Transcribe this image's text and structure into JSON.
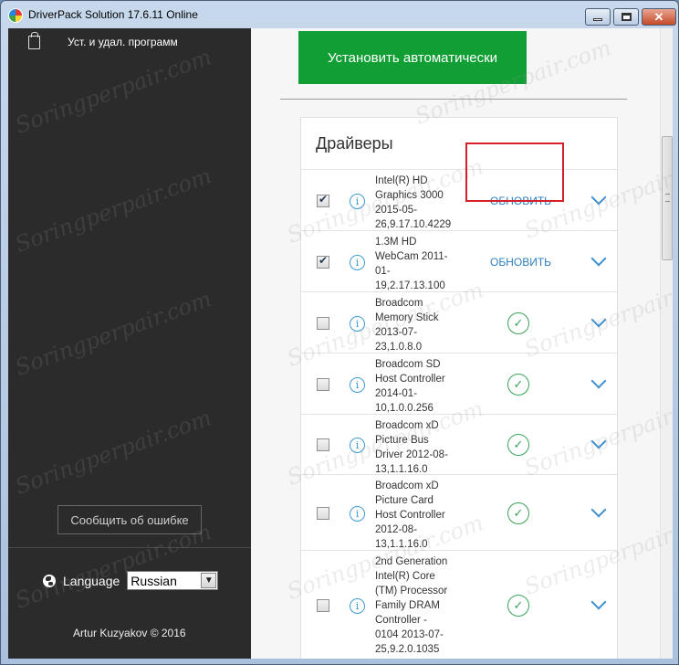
{
  "window": {
    "title": "DriverPack Solution 17.6.11 Online"
  },
  "sidebar": {
    "items": [
      {
        "label": "Уст. и удал. программ",
        "icon": "shopping-bag-icon"
      }
    ],
    "report_button": "Сообщить об ошибке",
    "language_label": "Language",
    "language_value": "Russian",
    "copyright": "Artur Kuzyakov © 2016"
  },
  "main": {
    "install_button": "Установить автоматически",
    "drivers_title": "Драйверы",
    "update_label": "ОБНОВИТЬ",
    "drivers": [
      {
        "lines": [
          "Intel(R) HD",
          "Graphics 3000",
          "2015-05-",
          "26,9.17.10.4229"
        ],
        "checked": true,
        "status": "update"
      },
      {
        "lines": [
          "1.3M HD",
          "WebCam 2011-",
          "01-",
          "19,2.17.13.100"
        ],
        "checked": true,
        "status": "update"
      },
      {
        "lines": [
          "Broadcom",
          "Memory Stick",
          "2013-07-",
          "23,1.0.8.0"
        ],
        "checked": false,
        "status": "ok"
      },
      {
        "lines": [
          "Broadcom SD",
          "Host Controller",
          "2014-01-",
          "10,1.0.0.256"
        ],
        "checked": false,
        "status": "ok"
      },
      {
        "lines": [
          "Broadcom xD",
          "Picture Bus",
          "Driver 2012-08-",
          "13,1.1.16.0"
        ],
        "checked": false,
        "status": "ok"
      },
      {
        "lines": [
          "Broadcom xD",
          "Picture Card",
          "Host Controller",
          "2012-08-",
          "13,1.1.16.0"
        ],
        "checked": false,
        "status": "ok"
      },
      {
        "lines": [
          "2nd Generation",
          "Intel(R) Core",
          "(TM) Processor",
          "Family DRAM",
          "Controller -",
          "0104 2013-07-",
          "25,9.2.0.1035"
        ],
        "checked": false,
        "status": "ok"
      }
    ]
  },
  "watermark": "Soringperpair.com",
  "colors": {
    "accent_green": "#119f35",
    "link_blue": "#2d7fbf",
    "highlight_red": "#d71f2a",
    "sidebar_bg": "#2b2b2b"
  }
}
